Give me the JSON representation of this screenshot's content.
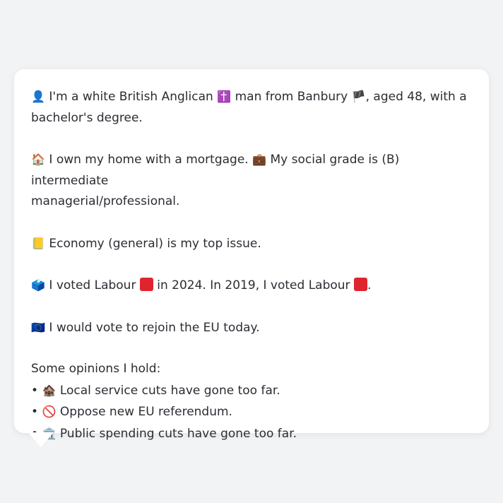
{
  "profile": {
    "identity": {
      "icon": "bust-silhouette",
      "pre": "I'm a white British Anglican",
      "religion_icon": "latin-cross",
      "mid": "man from Banbury",
      "flag_icon": "flag-england",
      "post": ", aged 48, with a",
      "line2": "bachelor's degree."
    },
    "home": {
      "icon": "house",
      "text1": "I own my home with a mortgage.",
      "briefcase_icon": "briefcase",
      "text2": "My social grade is (B) intermediate",
      "line2": "managerial/professional."
    },
    "issue": {
      "icon": "ledger-book",
      "text": "Economy (general) is my top issue."
    },
    "vote": {
      "icon": "ballot-box",
      "text1": "I voted Labour",
      "party_color": "#e0242e",
      "text2": "in 2024. In 2019, I voted Labour",
      "text3": "."
    },
    "eu": {
      "icon": "flag-eu",
      "text": "I would vote to rejoin the EU today."
    },
    "opinions": {
      "heading": "Some opinions I hold:",
      "bullet": "•",
      "items": [
        {
          "icon": "derelict-house",
          "text": "Local service cuts have gone too far."
        },
        {
          "icon": "prohibited",
          "text": "Oppose new EU referendum."
        },
        {
          "icon": "classical-building",
          "text": "Public spending cuts have gone too far."
        }
      ]
    }
  }
}
